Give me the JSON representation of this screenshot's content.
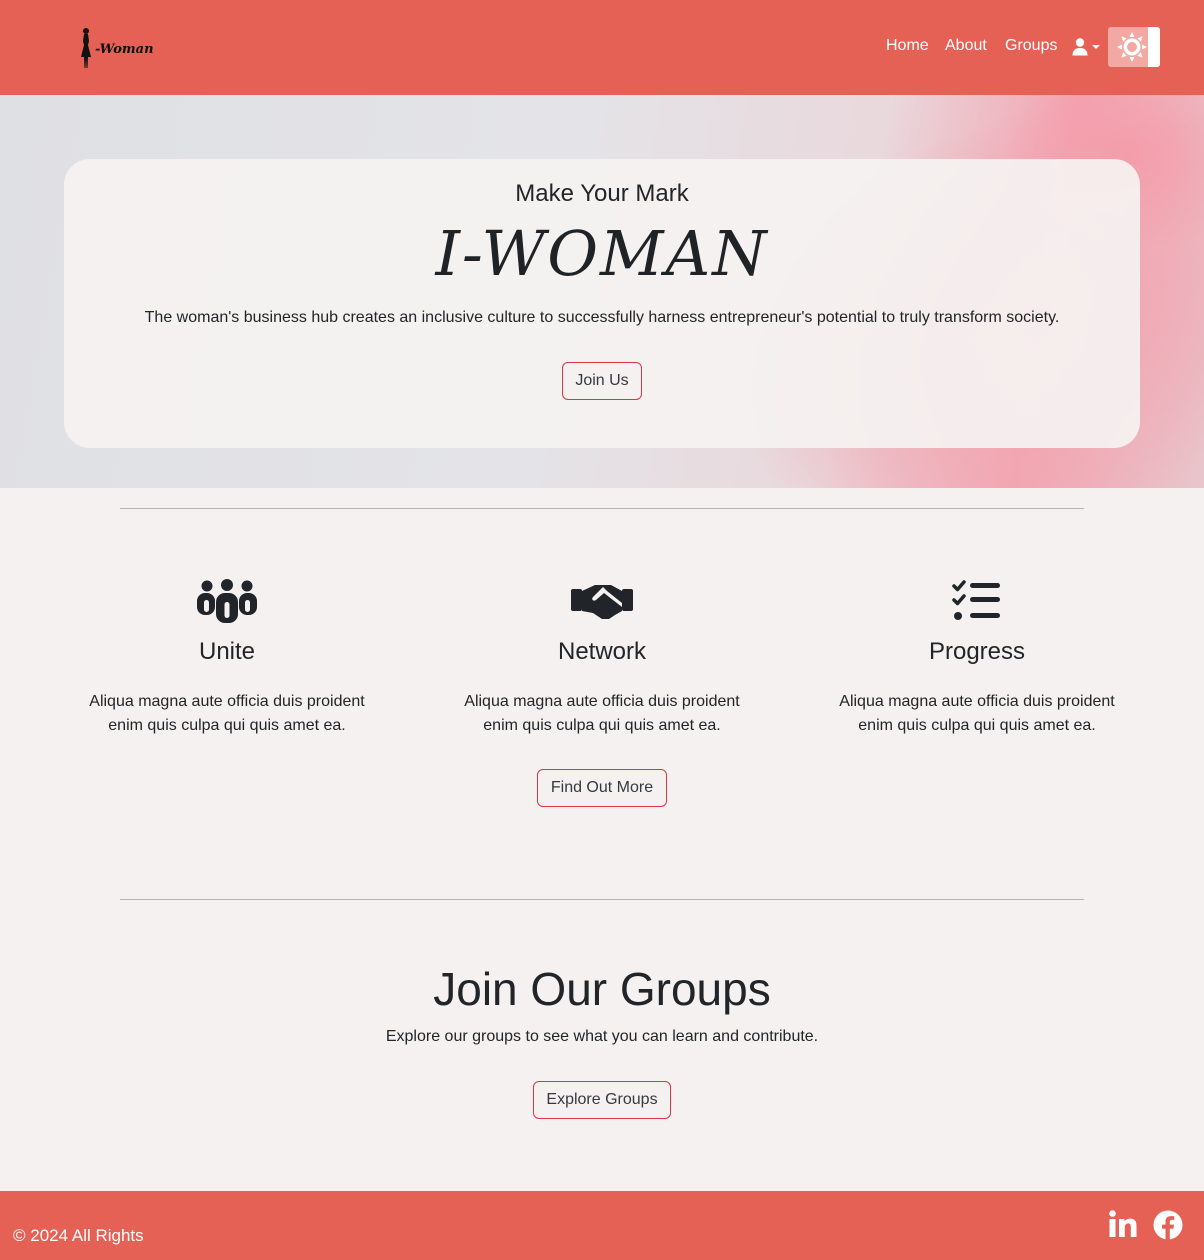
{
  "navbar": {
    "brand_text": "-Woman",
    "links": {
      "home": "Home",
      "about": "About",
      "groups": "Groups"
    },
    "user_icon": "user-icon",
    "theme_icon": "sun-icon"
  },
  "hero": {
    "eyebrow": "Make Your Mark",
    "title": "I-WOMAN",
    "text": "The woman's business hub creates an inclusive culture to successfully harness entrepreneur's potential to truly transform society.",
    "button": "Join Us"
  },
  "features": {
    "items": [
      {
        "icon": "people-group-icon",
        "title": "Unite",
        "text": "Aliqua magna aute officia duis proident enim quis culpa qui quis amet ea."
      },
      {
        "icon": "handshake-icon",
        "title": "Network",
        "text": "Aliqua magna aute officia duis proident enim quis culpa qui quis amet ea."
      },
      {
        "icon": "list-check-icon",
        "title": "Progress",
        "text": "Aliqua magna aute officia duis proident enim quis culpa qui quis amet ea."
      }
    ],
    "button": "Find Out More"
  },
  "groups": {
    "title": "Join Our Groups",
    "text": "Explore our groups to see what you can learn and contribute.",
    "button": "Explore Groups"
  },
  "footer": {
    "copyright": "© 2024 All Rights",
    "social": [
      "linkedin-icon",
      "facebook-icon"
    ]
  },
  "colors": {
    "brand": "#e56055",
    "background": "#f4f1f0",
    "button_border": "#dc3545",
    "text": "#212529"
  }
}
